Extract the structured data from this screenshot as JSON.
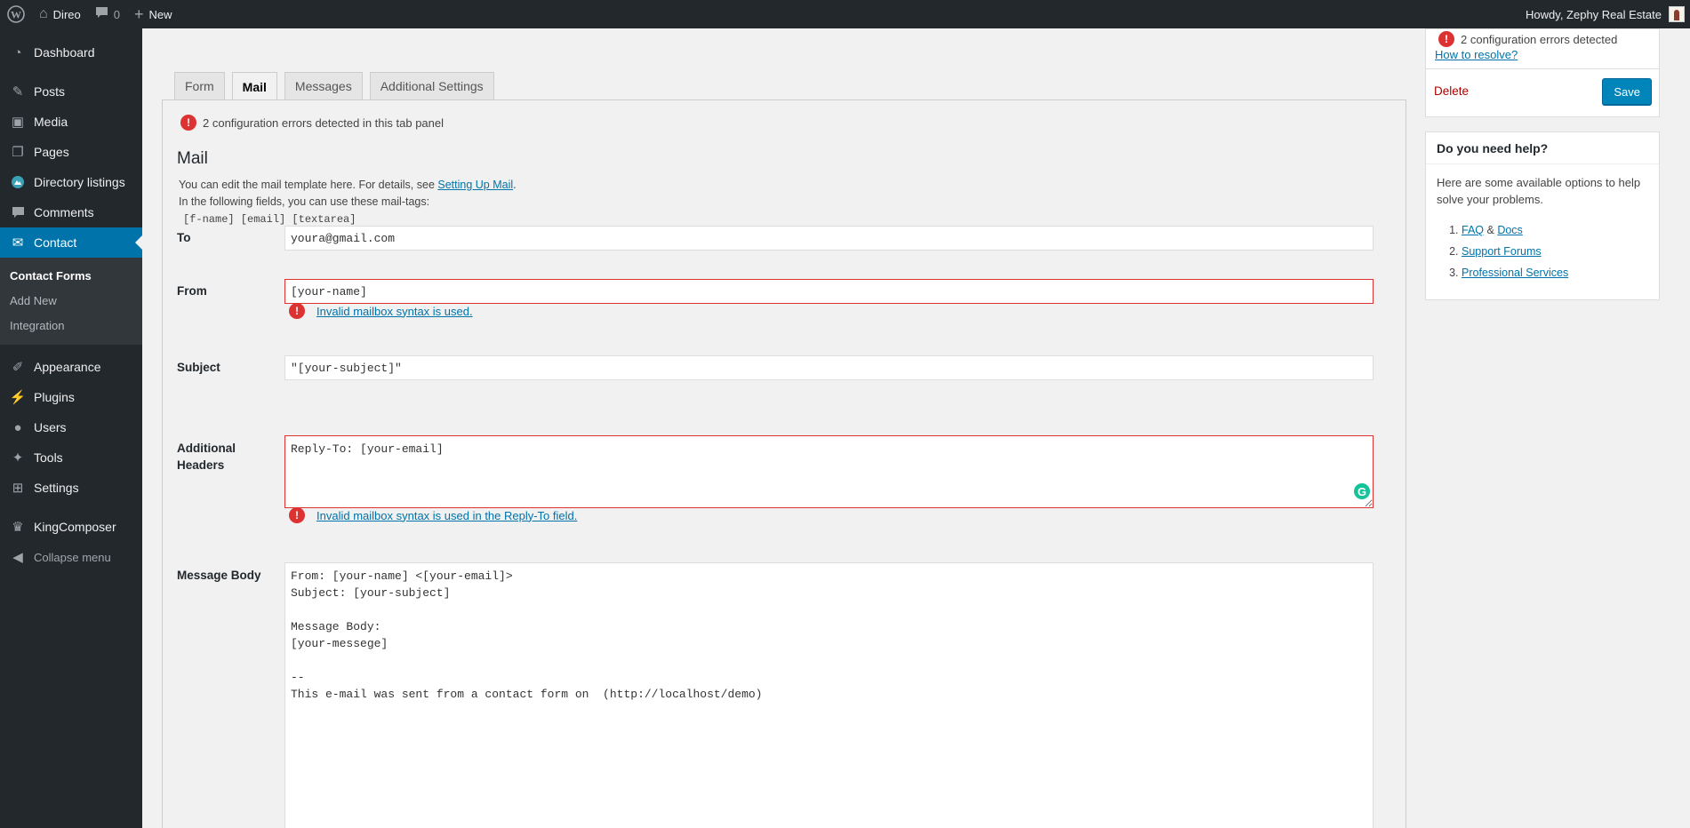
{
  "adminbar": {
    "site_name": "Direo",
    "comments_count": "0",
    "new_label": "New",
    "howdy": "Howdy, Zephy Real Estate"
  },
  "sidebar": {
    "items": [
      {
        "label": "Dashboard",
        "icon": "dashboard-icon"
      },
      {
        "label": "Posts",
        "icon": "pin-icon"
      },
      {
        "label": "Media",
        "icon": "media-icon"
      },
      {
        "label": "Pages",
        "icon": "pages-icon"
      },
      {
        "label": "Directory listings",
        "icon": "listings-icon"
      },
      {
        "label": "Comments",
        "icon": "comment-icon"
      },
      {
        "label": "Contact",
        "icon": "mail-icon"
      },
      {
        "label": "Appearance",
        "icon": "brush-icon"
      },
      {
        "label": "Plugins",
        "icon": "plugin-icon"
      },
      {
        "label": "Users",
        "icon": "user-icon"
      },
      {
        "label": "Tools",
        "icon": "wrench-icon"
      },
      {
        "label": "Settings",
        "icon": "settings-icon"
      },
      {
        "label": "KingComposer",
        "icon": "crown-icon"
      },
      {
        "label": "Collapse menu",
        "icon": "collapse-icon"
      }
    ],
    "submenu": [
      "Contact Forms",
      "Add New",
      "Integration"
    ]
  },
  "tabs": [
    "Form",
    "Mail",
    "Messages",
    "Additional Settings"
  ],
  "panel": {
    "error_summary": "2 configuration errors detected in this tab panel",
    "title": "Mail",
    "desc_line1": "You can edit the mail template here. For details, see ",
    "desc_link": "Setting Up Mail",
    "desc_line1_end": ".",
    "desc_line2": "In the following fields, you can use these mail-tags:",
    "mail_tags": "[f-name] [email] [textarea]"
  },
  "fields": {
    "to_label": "To",
    "to_value": "youra@gmail.com",
    "from_label": "From",
    "from_value": "[your-name]",
    "from_error": "Invalid mailbox syntax is used.",
    "subject_label": "Subject",
    "subject_value": "\"[your-subject]\"",
    "headers_label": "Additional Headers",
    "headers_value": "Reply-To: [your-email]",
    "headers_error": "Invalid mailbox syntax is used in the Reply-To field.",
    "body_label": "Message Body",
    "body_value": "From: [your-name] <[your-email]>\nSubject: [your-subject]\n\nMessage Body:\n[your-messege]\n\n--\nThis e-mail was sent from a contact form on  (http://localhost/demo)"
  },
  "submit_box": {
    "error_text": "2 configuration errors detected",
    "resolve_link": "How to resolve?",
    "delete_label": "Delete",
    "save_label": "Save"
  },
  "help_box": {
    "title": "Do you need help?",
    "text": "Here are some available options to help solve your problems.",
    "faq": "FAQ",
    "amp": "&",
    "docs": "Docs",
    "forums": "Support Forums",
    "services": "Professional Services"
  },
  "colors": {
    "admin_dark": "#23282d",
    "accent": "#0073aa",
    "error": "#dc3232",
    "grammarly": "#15c39a"
  }
}
